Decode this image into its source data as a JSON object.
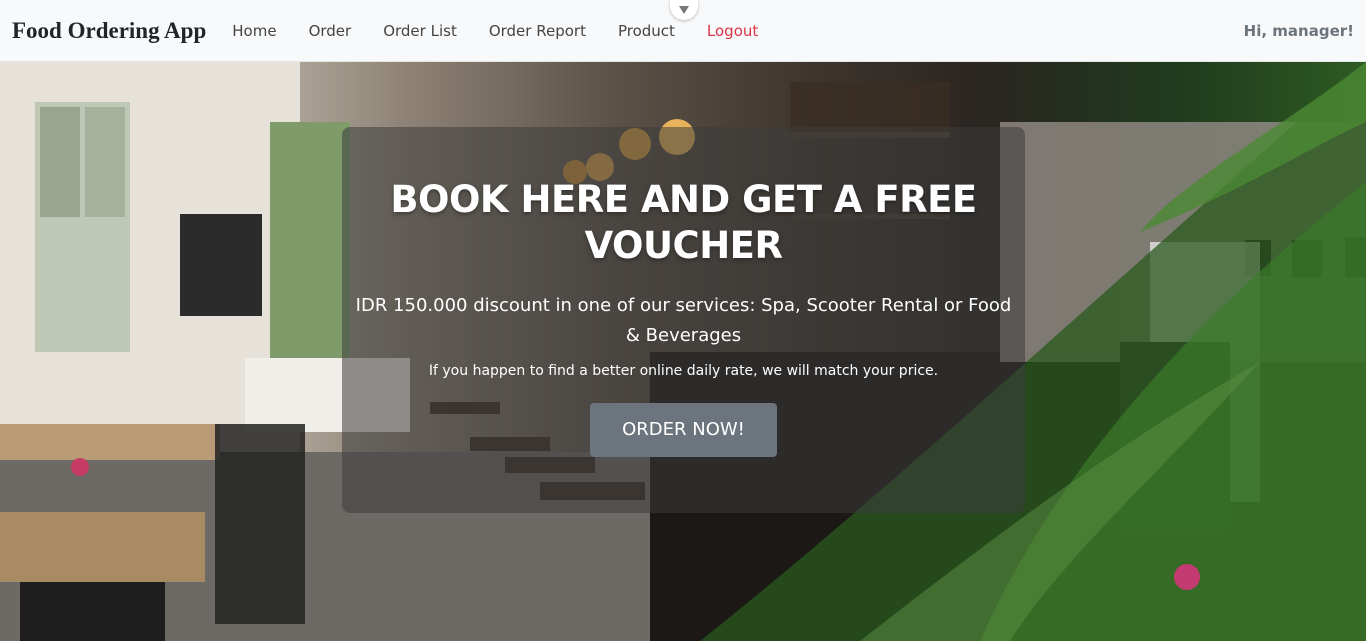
{
  "navbar": {
    "brand": "Food Ordering App",
    "links": [
      {
        "label": "Home"
      },
      {
        "label": "Order"
      },
      {
        "label": "Order List"
      },
      {
        "label": "Order Report"
      },
      {
        "label": "Product"
      },
      {
        "label": "Logout"
      }
    ],
    "greeting": "Hi, manager!",
    "logout_color": "#dc3545"
  },
  "hero": {
    "title": "BOOK HERE AND GET A FREE VOUCHER",
    "subtitle": "IDR 150.000 discount in one of our services: Spa, Scooter Rental or Food & Beverages",
    "note": "If you happen to find a better online daily rate, we will match your price.",
    "cta_label": "ORDER NOW!",
    "cta_color": "#6c757d"
  },
  "icons": {
    "scroll_toggle": "chevron-down-icon",
    "background": "restaurant-interior-photo"
  }
}
